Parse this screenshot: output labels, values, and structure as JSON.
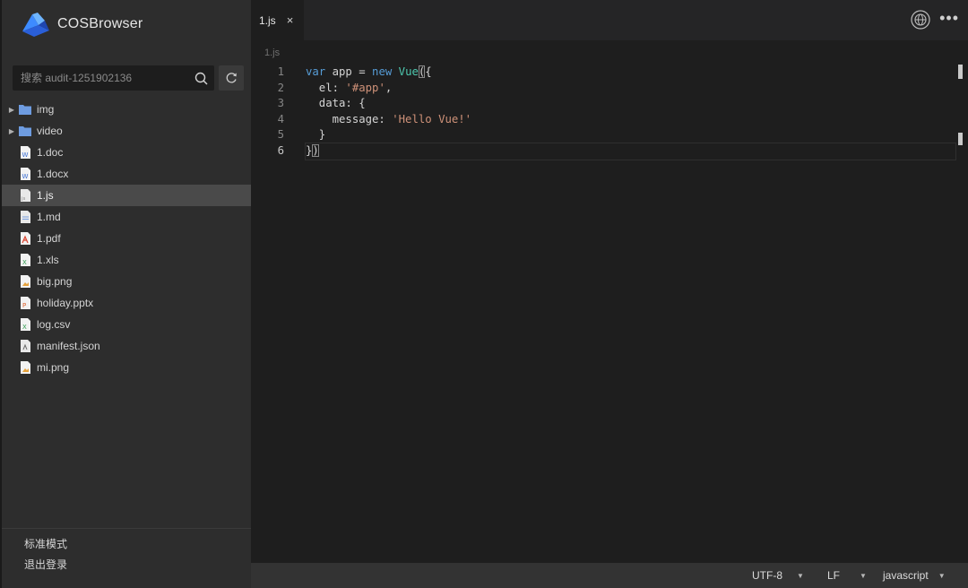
{
  "app": {
    "title": "COSBrowser"
  },
  "search": {
    "placeholder": "搜索 audit-1251902136"
  },
  "files": [
    {
      "name": "img",
      "type": "folder",
      "icon": "folder-icon"
    },
    {
      "name": "video",
      "type": "folder",
      "icon": "folder-icon"
    },
    {
      "name": "1.doc",
      "type": "file",
      "icon": "word-file-icon"
    },
    {
      "name": "1.docx",
      "type": "file",
      "icon": "word-file-icon"
    },
    {
      "name": "1.js",
      "type": "file",
      "icon": "js-file-icon",
      "selected": true
    },
    {
      "name": "1.md",
      "type": "file",
      "icon": "text-file-icon"
    },
    {
      "name": "1.pdf",
      "type": "file",
      "icon": "pdf-file-icon"
    },
    {
      "name": "1.xls",
      "type": "file",
      "icon": "excel-file-icon"
    },
    {
      "name": "big.png",
      "type": "file",
      "icon": "image-file-icon"
    },
    {
      "name": "holiday.pptx",
      "type": "file",
      "icon": "ppt-file-icon"
    },
    {
      "name": "log.csv",
      "type": "file",
      "icon": "excel-file-icon"
    },
    {
      "name": "manifest.json",
      "type": "file",
      "icon": "json-file-icon"
    },
    {
      "name": "mi.png",
      "type": "file",
      "icon": "image-file-icon"
    }
  ],
  "footer": {
    "mode_label": "标准模式",
    "logout_label": "退出登录"
  },
  "tab": {
    "name": "1.js",
    "close": "×"
  },
  "breadcrumb": "1.js",
  "editor": {
    "line_numbers": [
      "1",
      "2",
      "3",
      "4",
      "5",
      "6"
    ],
    "lines": [
      "var app = new Vue({",
      "  el: '#app',",
      "  data: {",
      "    message: 'Hello Vue!'",
      "  }",
      "})"
    ],
    "current_line": 6
  },
  "status": {
    "encoding": "UTF-8",
    "eol": "LF",
    "language": "javascript"
  },
  "colors": {
    "keyword": "#569cd6",
    "class": "#4ec9b0",
    "string": "#ce9178",
    "brand_blue": "#3d8bff"
  }
}
